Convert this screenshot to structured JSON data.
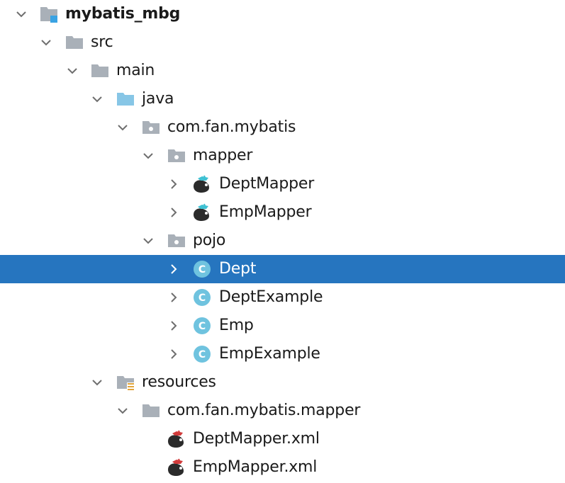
{
  "tree": {
    "items": [
      {
        "label": "mybatis_mbg",
        "icon": "module-folder-icon",
        "expanded": true,
        "bold": true
      },
      {
        "label": "src",
        "icon": "folder-icon",
        "expanded": true
      },
      {
        "label": "main",
        "icon": "folder-icon",
        "expanded": true
      },
      {
        "label": "java",
        "icon": "source-root-folder-icon",
        "expanded": true
      },
      {
        "label": "com.fan.mybatis",
        "icon": "package-icon",
        "expanded": true
      },
      {
        "label": "mapper",
        "icon": "package-icon",
        "expanded": true
      },
      {
        "label": "DeptMapper",
        "icon": "mybatis-interface-icon",
        "expanded": false
      },
      {
        "label": "EmpMapper",
        "icon": "mybatis-interface-icon",
        "expanded": false
      },
      {
        "label": "pojo",
        "icon": "package-icon",
        "expanded": true
      },
      {
        "label": "Dept",
        "icon": "class-icon",
        "expanded": false,
        "selected": true
      },
      {
        "label": "DeptExample",
        "icon": "class-icon",
        "expanded": false
      },
      {
        "label": "Emp",
        "icon": "class-icon",
        "expanded": false
      },
      {
        "label": "EmpExample",
        "icon": "class-icon",
        "expanded": false
      },
      {
        "label": "resources",
        "icon": "resources-folder-icon",
        "expanded": true
      },
      {
        "label": "com.fan.mybatis.mapper",
        "icon": "folder-icon",
        "expanded": true
      },
      {
        "label": "DeptMapper.xml",
        "icon": "mybatis-xml-icon"
      },
      {
        "label": "EmpMapper.xml",
        "icon": "mybatis-xml-icon"
      }
    ],
    "colors": {
      "selection": "#2675bf",
      "folder": "#a9b0b8",
      "source_folder": "#87c6e6",
      "class_badge": "#6fc3df",
      "module_marker": "#3aa3e3"
    }
  }
}
